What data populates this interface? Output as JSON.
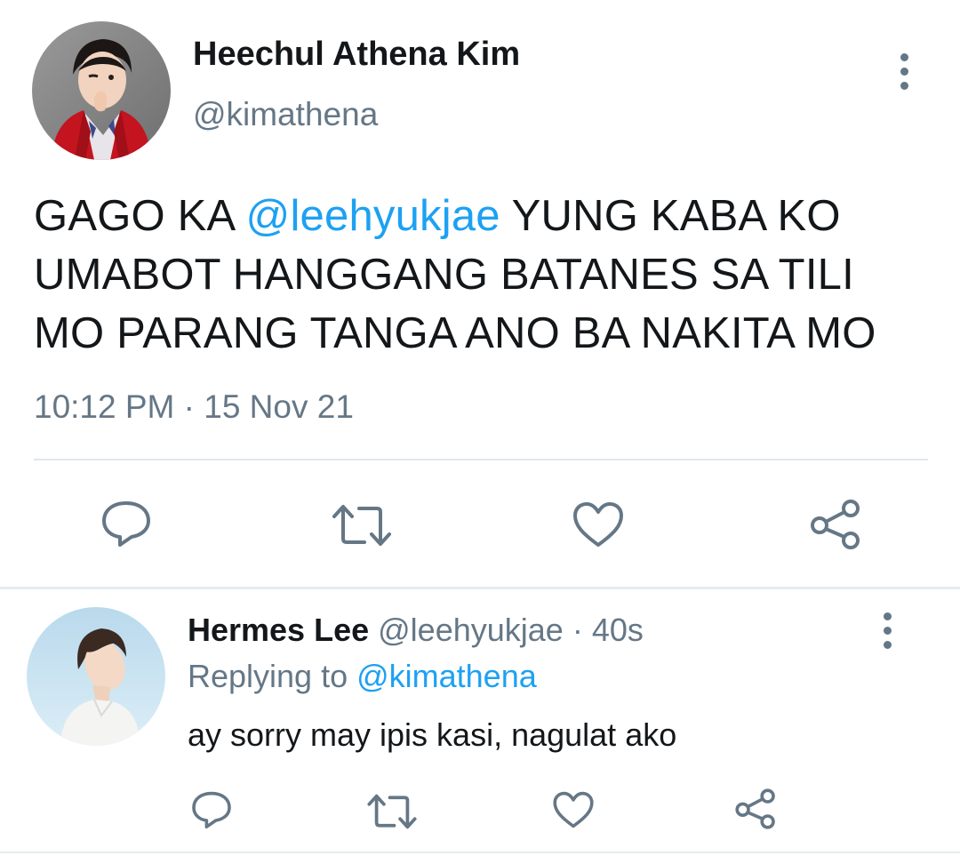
{
  "main_tweet": {
    "display_name": "Heechul Athena Kim",
    "handle": "@kimathena",
    "text_lines": [
      {
        "before": "GAGO KA ",
        "mention": "@leehyukjae",
        "after": " YUNG KABA KO"
      },
      {
        "text": "UMABOT HANGGANG BATANES SA TILI"
      },
      {
        "text": "MO PARANG TANGA ANO BA NAKITA MO"
      }
    ],
    "timestamp": "10:12 PM · 15 Nov 21",
    "actions": [
      "reply-icon",
      "retweet-icon",
      "like-icon",
      "share-icon"
    ]
  },
  "reply": {
    "display_name": "Hermes Lee",
    "handle": "@leehyukjae",
    "separator": " · ",
    "time_ago": "40s",
    "replying_to_label": "Replying to ",
    "replying_to_handle": "@kimathena",
    "text": "ay sorry may ipis kasi, nagulat ako",
    "actions": [
      "reply-icon",
      "retweet-icon",
      "like-icon",
      "share-icon"
    ]
  },
  "colors": {
    "text": "#14171a",
    "secondary": "#657786",
    "accent": "#1da1f2",
    "divider": "#e1e8ed"
  }
}
